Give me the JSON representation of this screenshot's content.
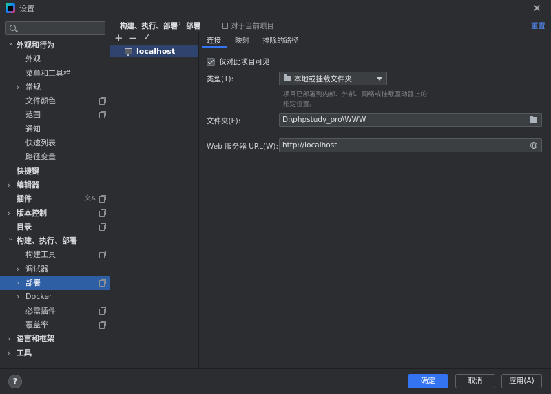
{
  "window": {
    "title": "设置",
    "close_icon": "✕"
  },
  "sidebar": {
    "search_placeholder": "",
    "items": [
      {
        "label": "外观和行为",
        "level": 0,
        "chevron": "down",
        "bold": true
      },
      {
        "label": "外观",
        "level": 1
      },
      {
        "label": "菜单和工具栏",
        "level": 1
      },
      {
        "label": "常规",
        "level": 1,
        "chevron": "right"
      },
      {
        "label": "文件颜色",
        "level": 1,
        "copy": true
      },
      {
        "label": "范围",
        "level": 1,
        "copy": true
      },
      {
        "label": "通知",
        "level": 1
      },
      {
        "label": "快速列表",
        "level": 1
      },
      {
        "label": "路径变量",
        "level": 1
      },
      {
        "label": "快捷键",
        "level": 0,
        "bold": true
      },
      {
        "label": "编辑器",
        "level": 0,
        "chevron": "right",
        "bold": true
      },
      {
        "label": "插件",
        "level": 0,
        "bold": true,
        "copy": true,
        "lang": true
      },
      {
        "label": "版本控制",
        "level": 0,
        "chevron": "right",
        "bold": true,
        "copy": true
      },
      {
        "label": "目录",
        "level": 0,
        "bold": true,
        "copy": true
      },
      {
        "label": "构建、执行、部署",
        "level": 0,
        "chevron": "down",
        "bold": true
      },
      {
        "label": "构建工具",
        "level": 1,
        "copy": true
      },
      {
        "label": "调试器",
        "level": 1,
        "chevron": "right"
      },
      {
        "label": "部署",
        "level": 1,
        "chevron": "right",
        "copy": true,
        "selected": true
      },
      {
        "label": "Docker",
        "level": 1,
        "chevron": "right"
      },
      {
        "label": "必需插件",
        "level": 1,
        "copy": true
      },
      {
        "label": "覆盖率",
        "level": 1,
        "copy": true
      },
      {
        "label": "语言和框架",
        "level": 0,
        "chevron": "right",
        "bold": true
      },
      {
        "label": "工具",
        "level": 0,
        "chevron": "right",
        "bold": true
      }
    ]
  },
  "breadcrumb": {
    "items": [
      "构建、执行、部署",
      "部署"
    ],
    "separator": "›",
    "project_scope": "对于当前项目",
    "reset_label": "重置"
  },
  "servers": {
    "toolbar": {
      "add": "+",
      "remove": "−",
      "apply": "✓"
    },
    "items": [
      {
        "label": "localhost",
        "selected": true
      }
    ]
  },
  "tabs": [
    {
      "label": "连接",
      "active": true
    },
    {
      "label": "映射",
      "active": false
    },
    {
      "label": "排除的路径",
      "active": false
    }
  ],
  "form": {
    "visible_only_label": "仅对此项目可见",
    "visible_only_checked": true,
    "type_label": "类型(T):",
    "type_value": "本地或挂载文件夹",
    "type_hint_line1": "项目已部署到内部、外部、网络或挂载驱动器上的",
    "type_hint_line2": "指定位置。",
    "folder_label": "文件夹(F):",
    "folder_value": "D:\\phpstudy_pro\\WWW",
    "url_label": "Web 服务器 URL(W):",
    "url_value": "http://localhost"
  },
  "footer": {
    "help_label": "?",
    "ok_label": "确定",
    "cancel_label": "取消",
    "apply_label": "应用(A)"
  },
  "colors": {
    "background": "#2b2d30",
    "selection": "#2e5ea3",
    "accent": "#3574f0",
    "link": "#548af7"
  }
}
